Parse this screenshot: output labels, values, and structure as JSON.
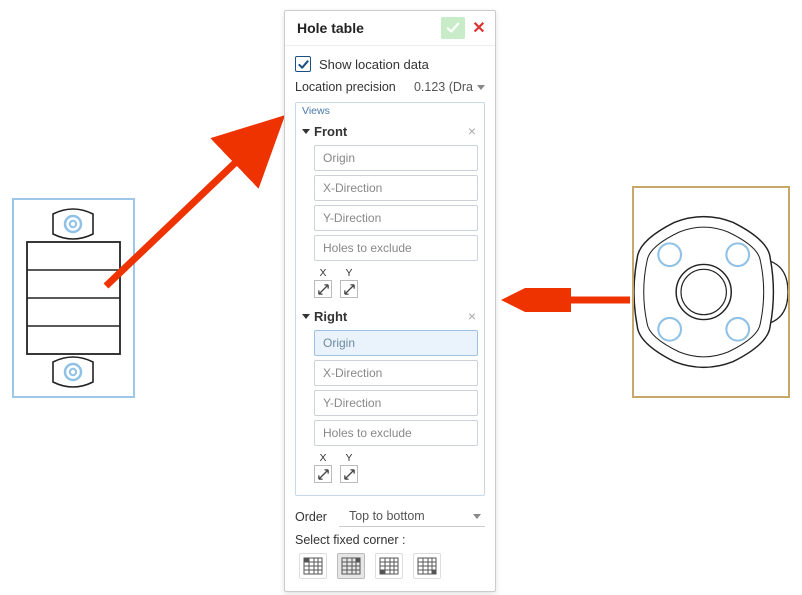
{
  "panel": {
    "title": "Hole table",
    "show_location_data_label": "Show location data",
    "location_precision_label": "Location precision",
    "location_precision_value": "0.123 (Dra",
    "views_label": "Views",
    "order_label": "Order",
    "order_value": "Top to bottom",
    "select_corner_label": "Select fixed corner :",
    "x_label": "X",
    "y_label": "Y"
  },
  "views": [
    {
      "name": "Front",
      "fields": [
        "Origin",
        "X-Direction",
        "Y-Direction",
        "Holes to exclude"
      ],
      "selected_field_index": -1
    },
    {
      "name": "Right",
      "fields": [
        "Origin",
        "X-Direction",
        "Y-Direction",
        "Holes to exclude"
      ],
      "selected_field_index": 0
    }
  ]
}
